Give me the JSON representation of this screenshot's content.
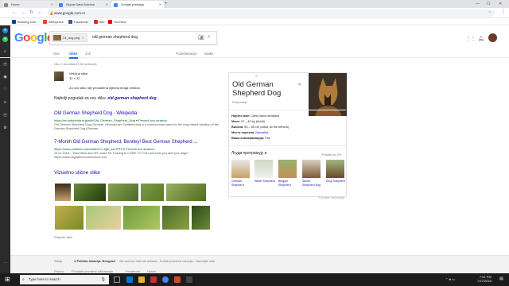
{
  "tabs": [
    {
      "label": "Home",
      "color": "#888"
    },
    {
      "label": "Skyne Data Science",
      "color": "#4285f4"
    },
    {
      "label": "Google pretraga",
      "color": "#4285f4"
    }
  ],
  "window_controls": {
    "min": "—",
    "max": "☐",
    "close": "✕"
  },
  "address": {
    "lock": "🔒",
    "url": "www.google.com.rs"
  },
  "bookmarks": [
    {
      "label": "Booking.com",
      "color": "#0b3b8c"
    },
    {
      "label": "AliExpress",
      "color": "#e8471c"
    },
    {
      "label": "Facebook",
      "color": "#3b5998"
    },
    {
      "label": "Blic",
      "color": "#d32f2f"
    },
    {
      "label": "YouTube",
      "color": "#e00"
    }
  ],
  "logo": [
    {
      "ch": "G",
      "color": "#4285f4"
    },
    {
      "ch": "o",
      "color": "#ea4335"
    },
    {
      "ch": "o",
      "color": "#fbbc05"
    },
    {
      "ch": "g",
      "color": "#4285f4"
    },
    {
      "ch": "l",
      "color": "#34a853"
    },
    {
      "ch": "e",
      "color": "#ea4335"
    }
  ],
  "search": {
    "chip": "24_dog.png",
    "chip_close": "×",
    "query": "old german shepherd dog"
  },
  "nav": {
    "tabs": [
      "Sve",
      "Slike",
      "Još"
    ],
    "tools": [
      "Podešavanja",
      "Alatke"
    ]
  },
  "results_stats": "Oko 2 rezultata (1,53 sekundi)",
  "image_info": {
    "title": "Veličina slike:",
    "size": "32 × 32"
  },
  "no_sizes": "Za ovu sliku nije pronađena nijedna druga veličina",
  "best_guess": {
    "prefix": "Najbolji pogodak za ovu sliku:",
    "query": "old german shepherd dog"
  },
  "results": [
    {
      "title": "Old German Shepherd Dog - Wikipedia",
      "url": "https://en.wikipedia.org/wiki/Old_German_Shepherd_Dog ▾ Prevedi ovu stranicu",
      "snippet": "Old German Shepherd Dog (German: Altdeutscher Schäferhund) is a controversial name for the long-haired variation of the German Shepherd Dog (German"
    },
    {
      "title": "7-Month Old German Shepherd, Bentley! Best German Shepherd ...",
      "url": "https://www.youtube.com/watch?v=5jjG_kwTPHI ▾ Prevedi ovu stranicu",
      "snippet": "15.01.2016. - Want Mick and OR Leash K9 Training to COME TO YOU and train you and your dogs? https://www.dogtrainersontheshore.com"
    }
  ],
  "similar_heading": "Vizuelno slične slike",
  "report": "Prijavite slike",
  "kp": {
    "title": "Old German Shepherd Dog",
    "subtitle": "Pasa rasa",
    "share": "⋖",
    "facts": [
      {
        "k": "Научно име:",
        "v": "Canis lupus familiaris",
        "link": false
      },
      {
        "k": "Маса:",
        "v": "22 – 40 kg (Adult)",
        "link": false
      },
      {
        "k": "Висина:",
        "v": "55 – 65 cm (Adult, At the withers)",
        "link": false
      },
      {
        "k": "Место порекла:",
        "v": "Nemačka",
        "link": true
      },
      {
        "k": "Виша класификација:",
        "v": "Pas",
        "link": true
      }
    ],
    "related_heading": "Људи претражују и",
    "view_more": "Prikaži još 15+",
    "related": [
      "German Shepherd",
      "White Shepherd",
      "Belgian Shepherd",
      "Shiloh Shepherd Dog",
      "King Shepherd"
    ],
    "feedback": "Povratne informacije"
  },
  "footer": {
    "country": "Srbija",
    "location": "● Palilula lokacija, Beograd",
    "location_note": "- Na osnovu internet adrese - Koristi preciznu lokaciju - Saznajte više",
    "links": [
      "Pomoć",
      "Pošaljite povratne informacije",
      "Privatnost",
      "Uslovi"
    ]
  },
  "taskbar": {
    "search": "Type here to search",
    "time": "7:51 PM",
    "date": "7/17/2018"
  }
}
